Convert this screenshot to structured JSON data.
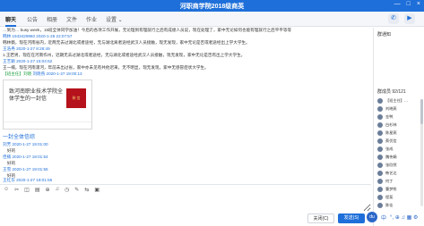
{
  "window": {
    "title": "河职商学院2018级商英",
    "min_icon": "—",
    "max_icon": "□",
    "close_icon": "×"
  },
  "tabs": [
    "聊天",
    "公告",
    "相册",
    "文件",
    "作业",
    "设置 ⌄"
  ],
  "chat": {
    "messages": [
      {
        "name": "",
        "time": "",
        "text": "…到为…  busy week，15班全体同学加油！今后的各项工作开展，无论理到有理就行之后有成绩人员说，现在处理了，家中无论如何也能有理就行之后平平等等"
      },
      {
        "name": "韩林",
        "time": "1943429960  2020-1-26 22:07:57",
        "text": ""
      },
      {
        "name": "",
        "time": "",
        "text": "韩林薇，现在河南省内，近两无去过湖北或者途经，无与湖北离者途经武汉人员接触，现无发现，家中无论是否或者途经出上学大学生。"
      },
      {
        "name": "王浩冉",
        "time": "2020-1-27 8:28:49",
        "text": ""
      },
      {
        "name": "",
        "time": "",
        "text": "1.王若男，现在在河南作州，近期无去过湖北或者途经，无与湖北或者途经武汉人员接触，现无发现，家中无论是否有出上学大学生。"
      },
      {
        "name": "王艺颖",
        "time": "2020-1-27 15:04:62",
        "text": ""
      },
      {
        "name": "",
        "time": "",
        "text": "王一楠，现在河南漯河，年前未出过省，家中亦未见有共他迟来，无不明显，现无发现，家中无感冒症状大学生。"
      },
      {
        "name": "【班主任】刘晓",
        "time": "刘晓燕  2020-1-27 19:00:13",
        "text": ""
      }
    ],
    "card": {
      "title": "致河南职业技术学院全体学生的一封信",
      "thumb_label": "致  信"
    },
    "link_title": "一封全体信综",
    "replies": [
      {
        "name": "刘芳",
        "time": "2020-1-27 19:01:00",
        "text": "好的"
      },
      {
        "name": "佳楠",
        "time": "2020-1-27 19:01:54",
        "text": "好的"
      },
      {
        "name": "王雪",
        "time": "2020-1-27 19:01:55",
        "text": "好的"
      },
      {
        "name": "王红华",
        "time": "2020-1-27 19:01:55",
        "text": "好的"
      }
    ]
  },
  "sidebar": {
    "announce_title": "群通知",
    "members_title": "群成员 92/121",
    "members": [
      "【班主任】…",
      "刘晓燕",
      "金鸭",
      "白杉林",
      "陈星燕",
      "蔡优信",
      "张成",
      "魏伟娟",
      "张欣然",
      "韩艺达",
      "何丁",
      "曹梦彤",
      "程斐",
      "陈佳"
    ]
  },
  "toolbar": {
    "icons": [
      "☺",
      "✂",
      "◫",
      "▤",
      "⊕",
      "♫",
      "◷",
      "✎",
      "⇆",
      "▣"
    ]
  },
  "buttons": {
    "close": "关闭(C)",
    "send": "发送(S)"
  },
  "ime": {
    "logo": "du",
    "mode": "中",
    "extra": "°, ⊕ ♫ ▦ ⚙"
  }
}
